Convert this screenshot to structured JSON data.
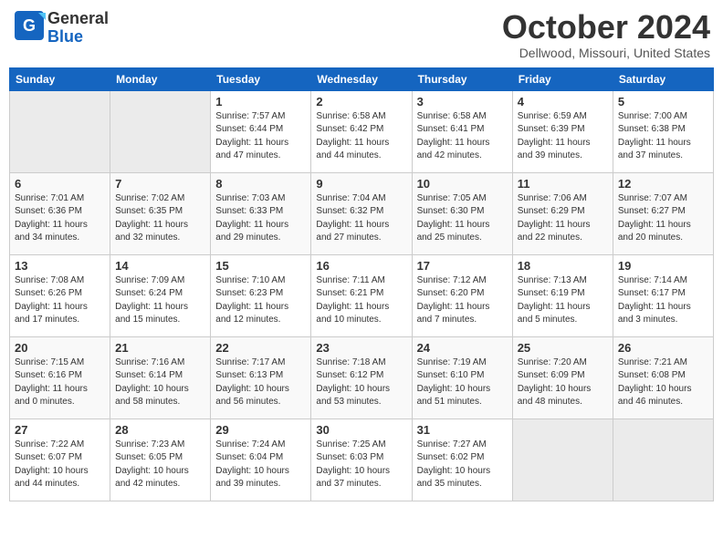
{
  "header": {
    "logo_general": "General",
    "logo_blue": "Blue",
    "month": "October 2024",
    "location": "Dellwood, Missouri, United States"
  },
  "days_of_week": [
    "Sunday",
    "Monday",
    "Tuesday",
    "Wednesday",
    "Thursday",
    "Friday",
    "Saturday"
  ],
  "weeks": [
    [
      null,
      null,
      {
        "date": "1",
        "sunrise": "7:57 AM",
        "sunset": "6:44 PM",
        "daylight": "11 hours and 47 minutes."
      },
      {
        "date": "2",
        "sunrise": "6:58 AM",
        "sunset": "6:42 PM",
        "daylight": "11 hours and 44 minutes."
      },
      {
        "date": "3",
        "sunrise": "6:58 AM",
        "sunset": "6:41 PM",
        "daylight": "11 hours and 42 minutes."
      },
      {
        "date": "4",
        "sunrise": "6:59 AM",
        "sunset": "6:39 PM",
        "daylight": "11 hours and 39 minutes."
      },
      {
        "date": "5",
        "sunrise": "7:00 AM",
        "sunset": "6:38 PM",
        "daylight": "11 hours and 37 minutes."
      }
    ],
    [
      {
        "date": "6",
        "sunrise": "7:01 AM",
        "sunset": "6:36 PM",
        "daylight": "11 hours and 34 minutes."
      },
      {
        "date": "7",
        "sunrise": "7:02 AM",
        "sunset": "6:35 PM",
        "daylight": "11 hours and 32 minutes."
      },
      {
        "date": "8",
        "sunrise": "7:03 AM",
        "sunset": "6:33 PM",
        "daylight": "11 hours and 29 minutes."
      },
      {
        "date": "9",
        "sunrise": "7:04 AM",
        "sunset": "6:32 PM",
        "daylight": "11 hours and 27 minutes."
      },
      {
        "date": "10",
        "sunrise": "7:05 AM",
        "sunset": "6:30 PM",
        "daylight": "11 hours and 25 minutes."
      },
      {
        "date": "11",
        "sunrise": "7:06 AM",
        "sunset": "6:29 PM",
        "daylight": "11 hours and 22 minutes."
      },
      {
        "date": "12",
        "sunrise": "7:07 AM",
        "sunset": "6:27 PM",
        "daylight": "11 hours and 20 minutes."
      }
    ],
    [
      {
        "date": "13",
        "sunrise": "7:08 AM",
        "sunset": "6:26 PM",
        "daylight": "11 hours and 17 minutes."
      },
      {
        "date": "14",
        "sunrise": "7:09 AM",
        "sunset": "6:24 PM",
        "daylight": "11 hours and 15 minutes."
      },
      {
        "date": "15",
        "sunrise": "7:10 AM",
        "sunset": "6:23 PM",
        "daylight": "11 hours and 12 minutes."
      },
      {
        "date": "16",
        "sunrise": "7:11 AM",
        "sunset": "6:21 PM",
        "daylight": "11 hours and 10 minutes."
      },
      {
        "date": "17",
        "sunrise": "7:12 AM",
        "sunset": "6:20 PM",
        "daylight": "11 hours and 7 minutes."
      },
      {
        "date": "18",
        "sunrise": "7:13 AM",
        "sunset": "6:19 PM",
        "daylight": "11 hours and 5 minutes."
      },
      {
        "date": "19",
        "sunrise": "7:14 AM",
        "sunset": "6:17 PM",
        "daylight": "11 hours and 3 minutes."
      }
    ],
    [
      {
        "date": "20",
        "sunrise": "7:15 AM",
        "sunset": "6:16 PM",
        "daylight": "11 hours and 0 minutes."
      },
      {
        "date": "21",
        "sunrise": "7:16 AM",
        "sunset": "6:14 PM",
        "daylight": "10 hours and 58 minutes."
      },
      {
        "date": "22",
        "sunrise": "7:17 AM",
        "sunset": "6:13 PM",
        "daylight": "10 hours and 56 minutes."
      },
      {
        "date": "23",
        "sunrise": "7:18 AM",
        "sunset": "6:12 PM",
        "daylight": "10 hours and 53 minutes."
      },
      {
        "date": "24",
        "sunrise": "7:19 AM",
        "sunset": "6:10 PM",
        "daylight": "10 hours and 51 minutes."
      },
      {
        "date": "25",
        "sunrise": "7:20 AM",
        "sunset": "6:09 PM",
        "daylight": "10 hours and 48 minutes."
      },
      {
        "date": "26",
        "sunrise": "7:21 AM",
        "sunset": "6:08 PM",
        "daylight": "10 hours and 46 minutes."
      }
    ],
    [
      {
        "date": "27",
        "sunrise": "7:22 AM",
        "sunset": "6:07 PM",
        "daylight": "10 hours and 44 minutes."
      },
      {
        "date": "28",
        "sunrise": "7:23 AM",
        "sunset": "6:05 PM",
        "daylight": "10 hours and 42 minutes."
      },
      {
        "date": "29",
        "sunrise": "7:24 AM",
        "sunset": "6:04 PM",
        "daylight": "10 hours and 39 minutes."
      },
      {
        "date": "30",
        "sunrise": "7:25 AM",
        "sunset": "6:03 PM",
        "daylight": "10 hours and 37 minutes."
      },
      {
        "date": "31",
        "sunrise": "7:27 AM",
        "sunset": "6:02 PM",
        "daylight": "10 hours and 35 minutes."
      },
      null,
      null
    ]
  ]
}
